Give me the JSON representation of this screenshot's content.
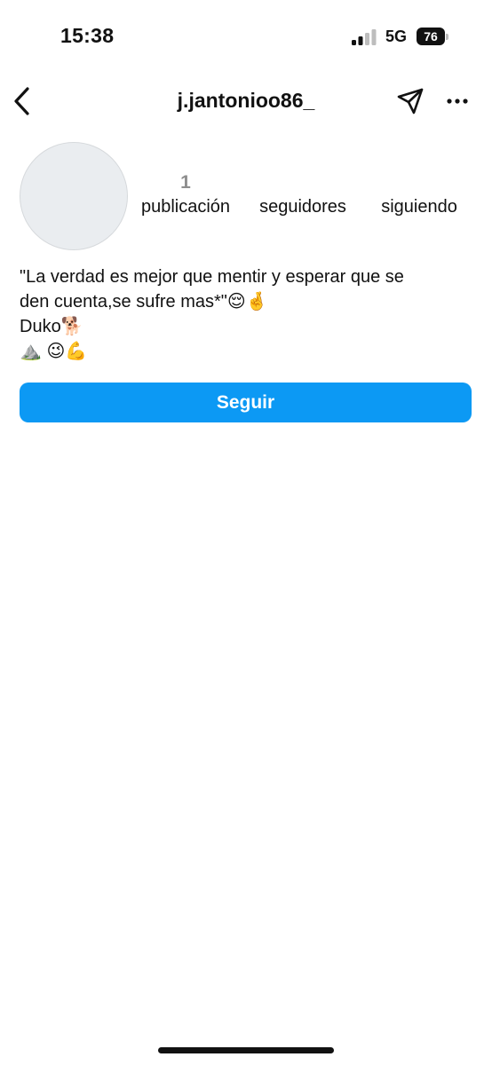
{
  "status_bar": {
    "time": "15:38",
    "network": "5G",
    "battery": "76",
    "icons": [
      "signal-bars-icon",
      "battery-icon"
    ]
  },
  "nav": {
    "title": "j.jantonioo86_",
    "icons": [
      "chevron-left-icon",
      "paper-plane-icon",
      "more-horizontal-icon"
    ]
  },
  "profile": {
    "stats": {
      "posts_value": "1",
      "posts_label": "publicación",
      "followers_value": "",
      "followers_label": "seguidores",
      "following_value": "",
      "following_label": "siguiendo"
    },
    "bio": {
      "line1": "\"La verdad es mejor que mentir y esperar que se",
      "line2": "den cuenta,se sufre mas*\"😌🤞",
      "line3": "Duko🐕",
      "line4": "⛰️ 😉💪"
    },
    "follow_label": "Seguir"
  },
  "colors": {
    "accent": "#0c99f4",
    "avatar_bg": "#eaedf0",
    "muted_text": "#8e8e8e"
  }
}
